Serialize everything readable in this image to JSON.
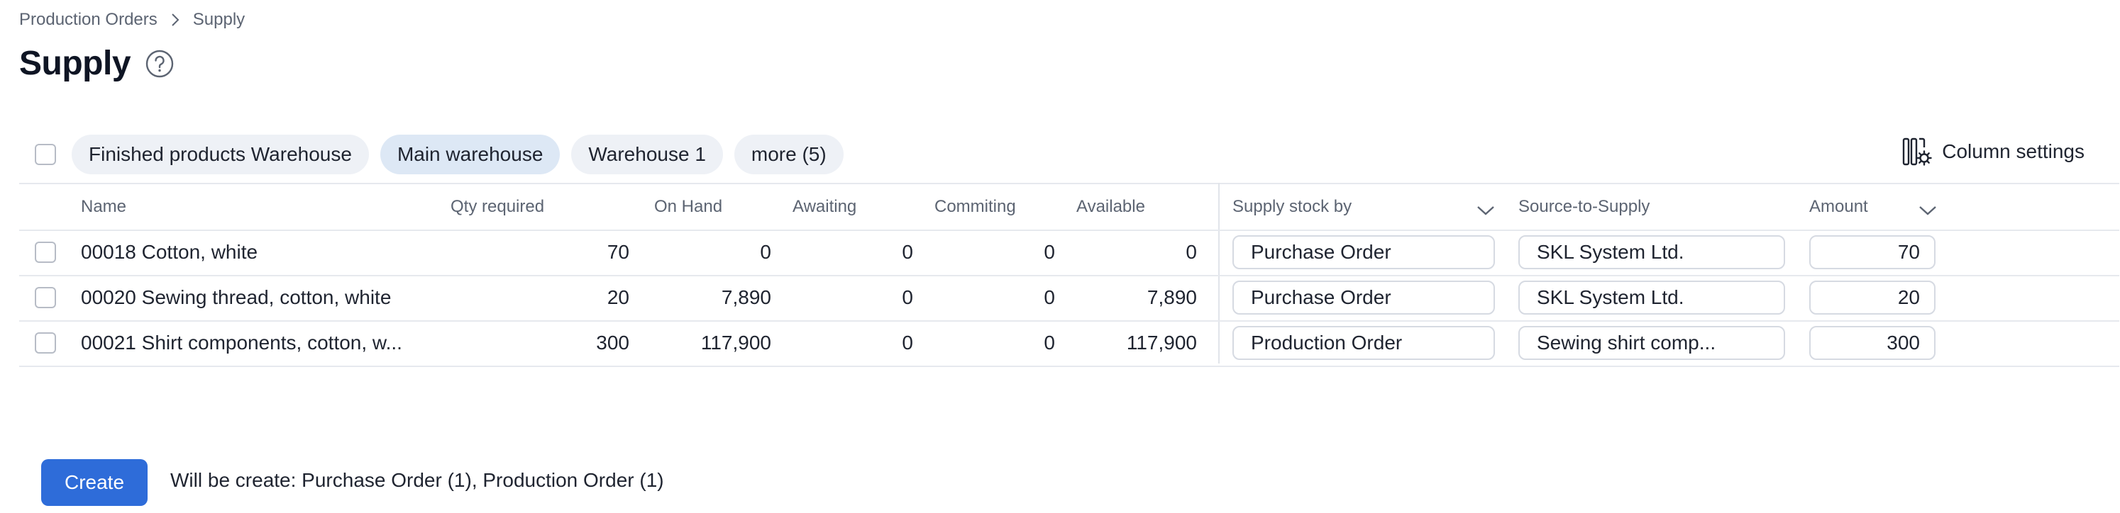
{
  "breadcrumb": {
    "parent": "Production Orders",
    "current": "Supply"
  },
  "page": {
    "title": "Supply"
  },
  "filters": {
    "chips": [
      {
        "label": "Finished products Warehouse",
        "active": false
      },
      {
        "label": "Main warehouse",
        "active": true
      },
      {
        "label": "Warehouse 1",
        "active": false
      },
      {
        "label": "more (5)",
        "active": false
      }
    ],
    "column_settings": "Column settings"
  },
  "table": {
    "headers": {
      "name": "Name",
      "qty_required": "Qty required",
      "on_hand": "On Hand",
      "awaiting": "Awaiting",
      "commiting": "Commiting",
      "available": "Available",
      "supply_stock_by": "Supply stock by",
      "source_to_supply": "Source-to-Supply",
      "amount": "Amount"
    },
    "rows": [
      {
        "name": "00018 Cotton, white",
        "qty_required": "70",
        "on_hand": "0",
        "awaiting": "0",
        "commiting": "0",
        "available": "0",
        "supply_stock_by": "Purchase Order",
        "source_to_supply": "SKL System Ltd.",
        "amount": "70"
      },
      {
        "name": "00020 Sewing thread, cotton, white",
        "qty_required": "20",
        "on_hand": "7,890",
        "awaiting": "0",
        "commiting": "0",
        "available": "7,890",
        "supply_stock_by": "Purchase Order",
        "source_to_supply": "SKL System Ltd.",
        "amount": "20"
      },
      {
        "name": "00021 Shirt components, cotton, w...",
        "qty_required": "300",
        "on_hand": "117,900",
        "awaiting": "0",
        "commiting": "0",
        "available": "117,900",
        "supply_stock_by": "Production Order",
        "source_to_supply": "Sewing shirt comp...",
        "amount": "300"
      }
    ]
  },
  "footer": {
    "create_label": "Create",
    "note": "Will be create: Purchase Order (1), Production Order (1)"
  },
  "colors": {
    "accent": "#2e6cd9",
    "chip_bg": "#eef1f6",
    "chip_active_bg": "#dde8f5"
  }
}
